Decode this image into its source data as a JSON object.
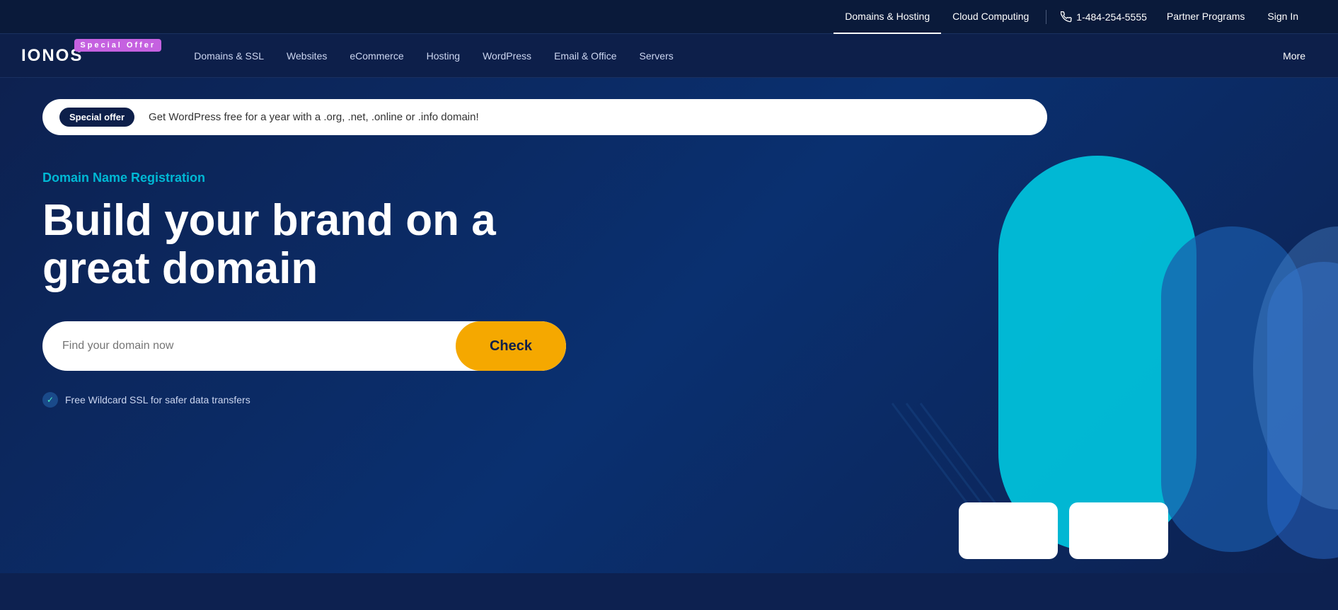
{
  "topbar": {
    "domains_hosting": "Domains & Hosting",
    "cloud_computing": "Cloud Computing",
    "phone": "1-484-254-5555",
    "partner_programs": "Partner Programs",
    "sign_in": "Sign In"
  },
  "nav": {
    "logo": "IONOS",
    "special_offer_badge": "Special Offer",
    "items": [
      {
        "label": "Domains & SSL"
      },
      {
        "label": "Websites"
      },
      {
        "label": "eCommerce"
      },
      {
        "label": "Hosting"
      },
      {
        "label": "WordPress"
      },
      {
        "label": "Email & Office"
      },
      {
        "label": "Servers"
      }
    ],
    "more": "More"
  },
  "hero": {
    "offer_tag": "Special offer",
    "offer_text": "Get WordPress free for a year with a .org, .net, .online or .info domain!",
    "subtitle": "Domain Name Registration",
    "title": "Build your brand on a great domain",
    "search_placeholder": "Find your domain now",
    "search_button": "Check",
    "ssl_text": "Free Wildcard SSL for safer data transfers"
  },
  "colors": {
    "accent_teal": "#00c8e0",
    "accent_blue": "#4a90d9",
    "accent_yellow": "#f5a800",
    "badge_purple": "#c561e0",
    "nav_bg": "#0d1f4a",
    "hero_bg": "#0d2150"
  }
}
